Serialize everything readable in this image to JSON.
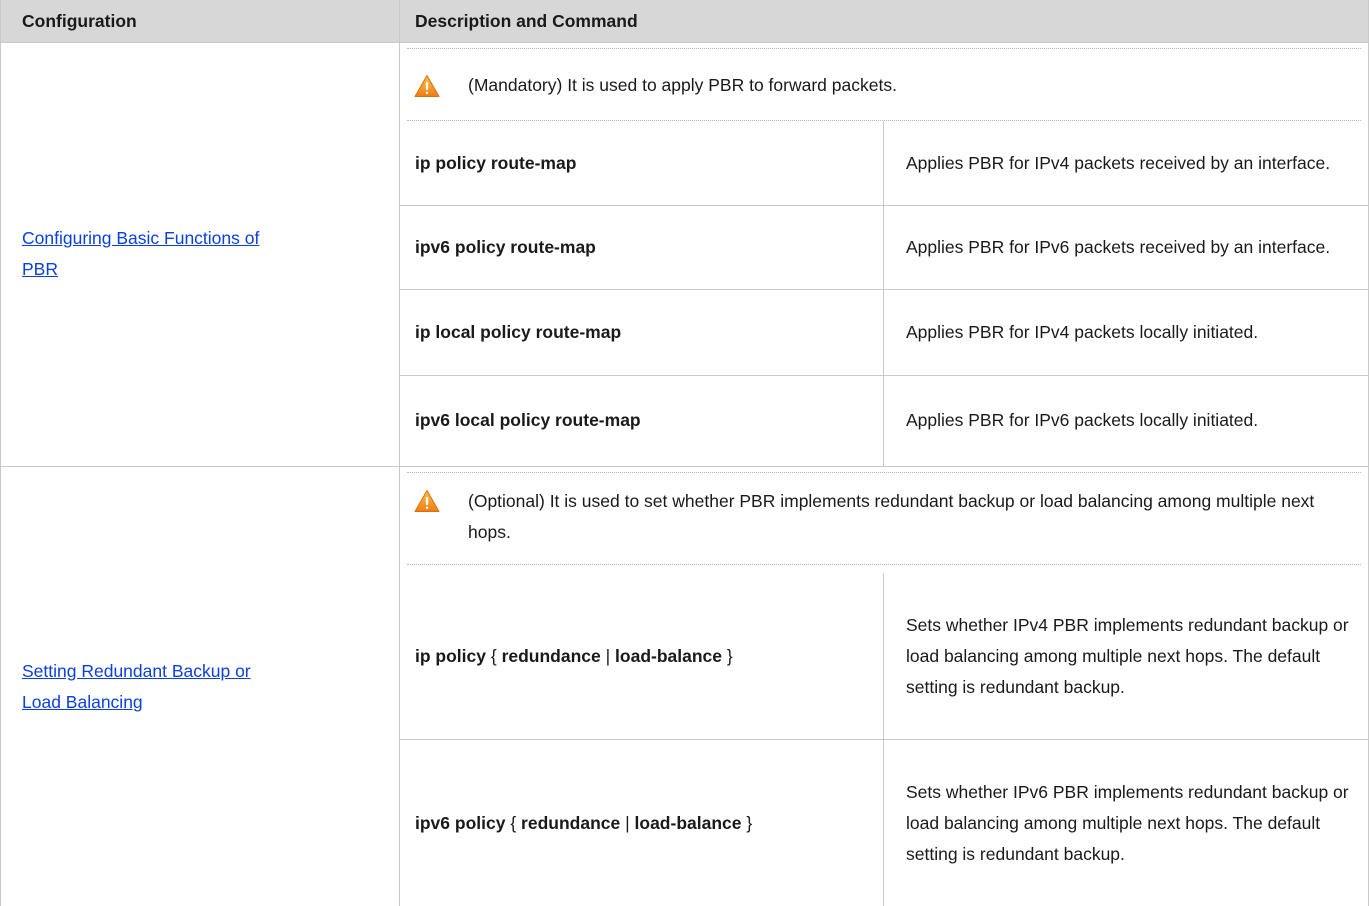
{
  "table": {
    "headers": [
      "Configuration",
      "Description and Command"
    ],
    "sections": [
      {
        "config_link": "Configuring Basic Functions of PBR",
        "config_lines": [
          "Configuring Basic Functions of ",
          "PBR"
        ],
        "note": "(Mandatory) It is used to apply PBR to forward packets.",
        "note_icon": "warning-icon",
        "rows": [
          {
            "command": "ip policy route-map",
            "description": "Applies PBR for IPv4 packets received by an interface."
          },
          {
            "command": "ipv6 policy route-map",
            "description": "Applies PBR for IPv6 packets received by an interface."
          },
          {
            "command": "ip local policy route-map",
            "description": "Applies PBR for IPv4 packets locally initiated."
          },
          {
            "command": "ipv6 local policy route-map",
            "description": "Applies PBR for IPv6 packets locally initiated."
          }
        ]
      },
      {
        "config_link": "Setting Redundant Backup or Load Balancing",
        "config_lines": [
          "Setting Redundant Backup or ",
          "Load Balancing"
        ],
        "note": "(Optional) It is used to set whether PBR implements redundant backup or load balancing among multiple next hops.",
        "note_icon": "warning-icon",
        "rows": [
          {
            "command_parts": [
              "ip policy",
              " { ",
              "redundance",
              " | ",
              "load-balance",
              " }"
            ],
            "description": "Sets whether IPv4 PBR implements redundant backup or load balancing among multiple next hops. The default setting is redundant backup."
          },
          {
            "command_parts": [
              "ipv6 policy",
              " { ",
              "redundance",
              " | ",
              "load-balance",
              " }"
            ],
            "description": "Sets whether IPv6 PBR implements redundant backup or load balancing among multiple next hops. The default setting is redundant backup."
          }
        ]
      }
    ]
  },
  "colors": {
    "header_bg": "#d7d7d7",
    "link": "#0b3fe0",
    "warning": "#f39a1e"
  }
}
